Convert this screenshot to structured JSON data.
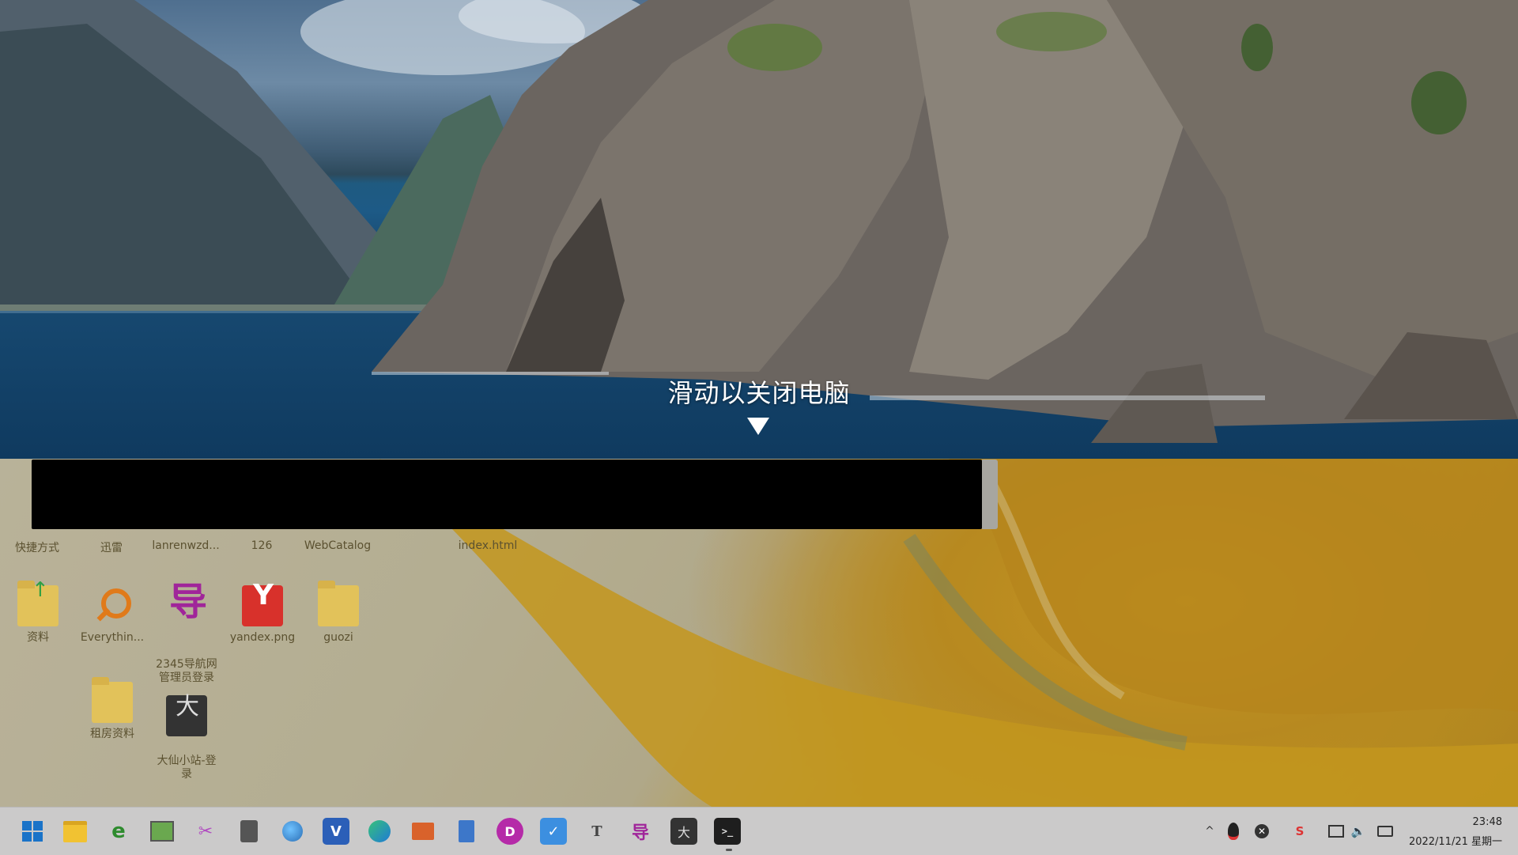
{
  "overlay": {
    "prompt": "滑动以关闭电脑",
    "arrow_icon": "arrow-down-icon"
  },
  "desktop_top_labels": [
    "快捷方式",
    "迅雷",
    "lanrenwzd...",
    "126",
    "WebCatalog",
    "index.html"
  ],
  "desktop_icons": [
    {
      "label": "资料",
      "icon": "folder-upload-icon"
    },
    {
      "label": "Everythin...",
      "icon": "magnifier-icon"
    },
    {
      "label": "2345导航网\n管理员登录",
      "icon": "dao-shortcut-icon",
      "glyph": "导"
    },
    {
      "label": "yandex.png",
      "icon": "yandex-image-icon",
      "glyph": "Y"
    },
    {
      "label": "guozi",
      "icon": "folder-icon"
    },
    {
      "label": "租房资料",
      "icon": "folder-icon"
    },
    {
      "label": "大仙小站-登\n录",
      "icon": "daxian-shortcut-icon",
      "glyph": "大"
    }
  ],
  "taskbar": {
    "apps": [
      {
        "name": "start-icon"
      },
      {
        "name": "file-explorer-icon"
      },
      {
        "name": "ie-browser-icon",
        "glyph": "e"
      },
      {
        "name": "image-editor-icon"
      },
      {
        "name": "scissors-tool-icon"
      },
      {
        "name": "calculator-icon"
      },
      {
        "name": "globe-browser-icon"
      },
      {
        "name": "visual-studio-icon",
        "glyph": "V"
      },
      {
        "name": "edge-icon"
      },
      {
        "name": "toolbox-icon"
      },
      {
        "name": "notepad-icon"
      },
      {
        "name": "d-app-icon",
        "glyph": "D"
      },
      {
        "name": "xcode-like-icon",
        "glyph": "✓"
      },
      {
        "name": "typora-icon",
        "glyph": "T"
      },
      {
        "name": "dao-taskbar-icon",
        "glyph": "导"
      },
      {
        "name": "daxian-taskbar-icon",
        "glyph": "大"
      },
      {
        "name": "terminal-icon",
        "glyph": ">_"
      }
    ],
    "tray": {
      "chevron": "^",
      "qq_icon": "qq-icon",
      "close_icon": "circle-x-icon",
      "s_icon": "s-app-icon",
      "network_icon": "network-icon",
      "volume_icon": "volume-icon",
      "battery_icon": "battery-icon"
    },
    "time": "23:48",
    "date": "2022/11/21 星期一"
  },
  "colors": {
    "taskbar_bg": "#cbcaca",
    "overlay_text": "#ffffff",
    "desktop_label": "#5b5130"
  }
}
